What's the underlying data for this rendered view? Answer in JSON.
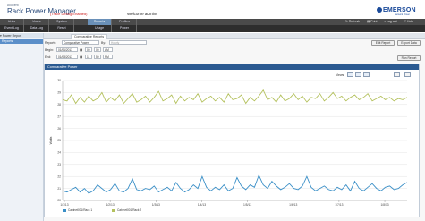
{
  "header": {
    "brand_small": "Avocent",
    "brand_big": "Rack Power Manager",
    "debug_notice": "(Trace Debug Enabled)",
    "welcome": "Welcome admin!",
    "logo": "EMERSON",
    "logo_sub": "Network Power"
  },
  "nav": {
    "row1": [
      "Units",
      "Users",
      "System",
      "Reports",
      "Profiles"
    ],
    "row2": [
      "Event Log",
      "Data Log",
      "Reset",
      "Usage",
      "Power"
    ],
    "active_row1": "Reports",
    "tools": [
      "Refresh",
      "Print",
      "Log out",
      "Help"
    ]
  },
  "sidebar": {
    "header": "Power Report",
    "items": [
      "Reports"
    ]
  },
  "main": {
    "tab": "Comparative Reports",
    "form": {
      "reports_label": "Reports:",
      "report_select": "Comparative Power",
      "by_label": "By:",
      "by_select": "Hourly",
      "begin_label": "Begin:",
      "begin_date": "01/01/2013",
      "begin_hour": "00",
      "begin_min": "00",
      "begin_ampm": "AM",
      "end_label": "End:",
      "end_date": "01/08/2013",
      "end_hour": "11",
      "end_min": "59",
      "end_ampm": "PM",
      "edit_report": "Edit Report",
      "export_data": "Export Data",
      "run_report": "Run Report"
    },
    "panel_title": "Comparative Power",
    "views_label": "Views:"
  },
  "chart_data": {
    "type": "line",
    "ylabel": "Watts",
    "ylim": [
      20,
      30
    ],
    "x_ticks": [
      "1/1/13",
      "1/2/13",
      "1/3/13",
      "1/4/13",
      "1/5/13",
      "1/6/13",
      "1/7/13",
      "1/8/13"
    ],
    "y_ticks": [
      20,
      21,
      22,
      23,
      24,
      25,
      26,
      27,
      28,
      29,
      30
    ],
    "series": [
      {
        "name": "Cabinet001/Rack 1",
        "color": "#3a8fc7",
        "values": [
          20.8,
          20.7,
          20.9,
          21.1,
          20.7,
          21.0,
          20.6,
          20.8,
          21.3,
          21.0,
          20.7,
          20.9,
          21.4,
          20.8,
          20.7,
          21.0,
          21.8,
          20.9,
          20.8,
          21.0,
          20.9,
          21.2,
          20.7,
          20.9,
          21.1,
          20.8,
          21.5,
          21.0,
          20.7,
          20.9,
          21.3,
          21.0,
          22.0,
          21.1,
          20.8,
          21.1,
          20.9,
          21.3,
          20.8,
          21.0,
          21.9,
          21.2,
          20.9,
          21.3,
          21.1,
          22.1,
          21.3,
          21.0,
          21.6,
          21.2,
          20.9,
          21.1,
          21.4,
          21.0,
          20.9,
          21.2,
          22.0,
          21.1,
          20.8,
          21.0,
          21.2,
          20.9,
          20.8,
          21.1,
          20.9,
          21.3,
          20.8,
          21.6,
          21.0,
          20.8,
          21.1,
          21.4,
          21.0,
          20.8,
          21.1,
          21.2,
          20.9,
          21.0,
          21.3,
          21.5
        ]
      },
      {
        "name": "Cabinet001/Rack 2",
        "color": "#b4c15e",
        "values": [
          28.4,
          28.3,
          28.8,
          28.1,
          28.6,
          28.2,
          28.7,
          28.3,
          28.5,
          29.0,
          28.2,
          28.6,
          28.3,
          28.8,
          28.1,
          28.5,
          28.9,
          28.2,
          28.4,
          28.7,
          28.2,
          28.6,
          29.1,
          28.3,
          28.5,
          28.8,
          28.1,
          28.7,
          28.3,
          28.6,
          28.4,
          28.9,
          28.2,
          28.5,
          28.7,
          28.3,
          28.6,
          28.2,
          28.9,
          28.4,
          28.5,
          28.8,
          28.1,
          28.6,
          28.3,
          28.7,
          29.2,
          28.4,
          28.6,
          28.2,
          28.8,
          28.3,
          28.5,
          28.9,
          28.4,
          28.7,
          28.2,
          28.6,
          28.5,
          28.9,
          28.3,
          28.6,
          29.0,
          28.5,
          28.7,
          28.3,
          28.6,
          28.8,
          28.4,
          28.6,
          28.9,
          28.3,
          28.5,
          28.7,
          28.4,
          28.6,
          28.3,
          28.5,
          28.4,
          28.6
        ]
      }
    ]
  }
}
